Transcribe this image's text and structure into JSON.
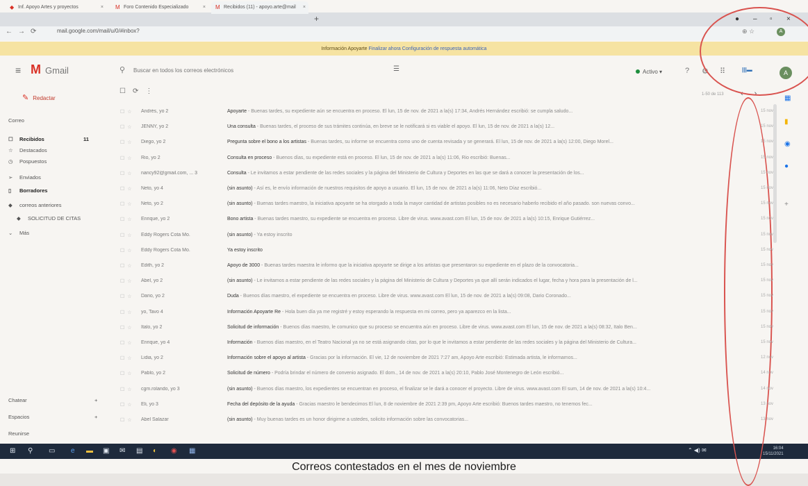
{
  "tabs": [
    {
      "label": "Inf. Apoyo Artes y proyectos"
    },
    {
      "label": "Foro Contenido Especializado"
    },
    {
      "label": "Recibidos (11) - apoyo.arte@mail"
    }
  ],
  "new_tab": "+",
  "url": "mail.google.com/mail/u/0/#inbox?",
  "banner": {
    "text": "Información Apoyarte",
    "link1": "Finalizar ahora",
    "link2": "Configuración de respuesta automática"
  },
  "app": {
    "name": "Gmail"
  },
  "search": {
    "placeholder": "Buscar en todos los correos electrónicos"
  },
  "status": {
    "label": "Activo ▾"
  },
  "compose": {
    "label": "Redactar"
  },
  "sidebar": {
    "section": "Correo",
    "items": [
      {
        "label": "Recibidos",
        "count": "11",
        "icon": "inbox-icon",
        "glyph": "☐"
      },
      {
        "label": "Destacados",
        "icon": "star-icon",
        "glyph": "☆"
      },
      {
        "label": "Pospuestos",
        "icon": "clock-icon",
        "glyph": "◷"
      },
      {
        "label": "Enviados",
        "icon": "send-icon",
        "glyph": "➢"
      },
      {
        "label": "Borradores",
        "icon": "draft-icon",
        "glyph": "▯"
      },
      {
        "label": "correos anteriores",
        "icon": "label-icon",
        "glyph": "◆"
      },
      {
        "label": "SOLICITUD DE CITAS",
        "icon": "label-icon",
        "glyph": "◆"
      },
      {
        "label": "Más",
        "icon": "chevron-down-icon",
        "glyph": "⌄"
      }
    ],
    "bottom": [
      {
        "label": "Chatear"
      },
      {
        "label": "Espacios"
      },
      {
        "label": "Reunirse"
      }
    ]
  },
  "toolbar": {
    "pager": "1-50 de 113"
  },
  "emails": [
    {
      "sender": "Andrés, yo 2",
      "subject": "Apoyarte",
      "snippet": " - Buenas tardes, su expediente aún se encuentra en proceso. El lun, 15 de nov. de 2021 a la(s) 17:34, Andrés Hernández escribió: se cumpla saludo...",
      "date": "15 nov"
    },
    {
      "sender": "JENNY, yo 2",
      "subject": "Una consulta",
      "snippet": " - Buenas tardes, el proceso de sus trámites continúa, en breve se le notificará si es viable el apoyo. El lun, 15 de nov. de 2021 a la(s) 12...",
      "date": "15 nov"
    },
    {
      "sender": "Diego, yo 2",
      "subject": "Pregunta sobre el bono a los artistas",
      "snippet": " - Buenas tardes, su informe se encuentra como uno de cuenta revisada y se generará. El lun, 15 de nov. de 2021 a la(s) 12:00, Diego Morel...",
      "date": "15 nov"
    },
    {
      "sender": "Rio, yo 2",
      "subject": "Consulta en proceso",
      "snippet": " - Buenos días, su expediente está en proceso. El lun, 15 de nov. de 2021 a la(s) 11:06, Rio escribió: Buenas...",
      "date": "15 nov"
    },
    {
      "sender": "nancy92@gmail.com, ... 3",
      "subject": "Consulta",
      "snippet": " - Le invitamos a estar pendiente de las redes sociales y la página del Ministerio de Cultura y Deportes en las que se dará a conocer la presentación de los...",
      "date": "15 nov"
    },
    {
      "sender": "Neto, yo 4",
      "subject": "(sin asunto)",
      "snippet": " - Así es, le envío información de nuestros requisitos de apoyo a usuario. El lun, 15 de nov. de 2021 a la(s) 11:06, Neto Díaz escribió...",
      "date": "15 nov"
    },
    {
      "sender": "Neto, yo 2",
      "subject": "(sin asunto)",
      "snippet": " - Buenas tardes maestro, la iniciativa apoyarte se ha otorgado a toda la mayor cantidad de artistas posibles no es necesario haberlo recibido el año pasado. son nuevas convo...",
      "date": "15 nov"
    },
    {
      "sender": "Enrique, yo 2",
      "subject": "Bono artista",
      "snippet": " - Buenas tardes maestro, su expediente se encuentra en proceso. Libre de virus. www.avast.com El lun, 15 de nov. de 2021 a la(s) 10:15, Enrique Gutiérrez...",
      "date": "15 nov"
    },
    {
      "sender": "Eddy Rogers Cota Mo.",
      "subject": "(sin asunto)",
      "snippet": " - Ya estoy inscrito",
      "date": "15 nov"
    },
    {
      "sender": "Eddy Rogers Cota Mo.",
      "subject": "Ya estoy inscrito",
      "snippet": "",
      "date": "15 nov"
    },
    {
      "sender": "Edith, yo 2",
      "subject": "Apoyo de 3000",
      "snippet": " - Buenas tardes maestra le informo que la iniciativa apoyarte se dirige a los artistas que presentaron su expediente en el plazo de la convocatoria...",
      "date": "15 nov"
    },
    {
      "sender": "Abel, yo 2",
      "subject": "(sin asunto)",
      "snippet": " - Le invitamos a estar pendiente de las redes sociales y la página del Ministerio de Cultura y Deportes ya que allí serán indicados el lugar, fecha y hora para la presentación de l...",
      "date": "15 nov"
    },
    {
      "sender": "Dario, yo 2",
      "subject": "Duda",
      "snippet": " - Buenos días maestro, el expediente se encuentra en proceso. Libre de virus. www.avast.com El lun, 15 de nov. de 2021 a la(s) 09:08, Dario Coronado...",
      "date": "15 nov"
    },
    {
      "sender": "yo, Tavo 4",
      "subject": "Información Apoyarte Re",
      "snippet": " - Hola buen día ya me registré y estoy esperando la respuesta en mi correo, pero ya aparezco en la lista...",
      "date": "15 nov"
    },
    {
      "sender": "Italo, yo 2",
      "subject": "Solicitud de información",
      "snippet": " - Buenos días maestro, le comunico que su proceso se encuentra aún en proceso. Libre de virus. www.avast.com El lun, 15 de nov. de 2021 a la(s) 08:32, Italo Ben...",
      "date": "15 nov"
    },
    {
      "sender": "Enrique, yo 4",
      "subject": "Información",
      "snippet": " - Buenos días maestro, en el Teatro Nacional ya no se está asignando citas, por lo que le invitamos a estar pendiente de las redes sociales y la página del Ministerio de Cultura...",
      "date": "15 nov"
    },
    {
      "sender": "Lidia, yo 2",
      "subject": "Información sobre el apoyo al artista",
      "snippet": " - Gracias por la información. El vie, 12 de noviembre de 2021 7:27 am, Apoyo Arte escribió: Estimada artista, le informamos...",
      "date": "12 nov"
    },
    {
      "sender": "Pablo, yo 2",
      "subject": "Solicitud de número",
      "snippet": " - Podría brindar el número de convenio asignado. El dom., 14 de nov. de 2021 a la(s) 20:10, Pablo José Montenegro de León escribió...",
      "date": "14 nov"
    },
    {
      "sender": "cgm.rolando, yo 3",
      "subject": "(sin asunto)",
      "snippet": " - Buenos días maestro, los expedientes se encuentran en proceso, el finalizar se le dará a conocer el proyecto. Libre de virus. www.avast.com El sum, 14 de nov. de 2021 a la(s) 10:4...",
      "date": "14 nov"
    },
    {
      "sender": "Eli, yo 3",
      "subject": "Fecha del depósito de la ayuda",
      "snippet": " - Gracias maestro le bendecimos El lun, 8 de noviembre de 2021 2:39 pm, Apoyo Arte escribió: Buenos tardes maestro, no tenemos fec...",
      "date": "13 nov"
    },
    {
      "sender": "Abel Salazar",
      "subject": "(sin asunto)",
      "snippet": " - Muy buenas tardes es un honor dirigirme a ustedes, solicito información sobre las convocatorias...",
      "date": "13 nov"
    }
  ],
  "taskbar": {
    "time": "16:04",
    "date": "15/11/2021"
  },
  "caption": "Correos contestados en el mes de noviembre"
}
